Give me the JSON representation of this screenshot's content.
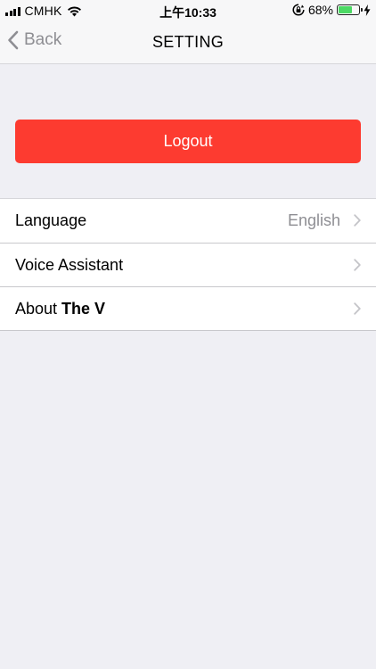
{
  "status_bar": {
    "carrier": "CMHK",
    "time": "上午10:33",
    "battery_percent": "68%",
    "battery_level": 0.68
  },
  "nav": {
    "back_label": "Back",
    "title": "SETTING"
  },
  "logout": {
    "label": "Logout",
    "color": "#fd3b30"
  },
  "settings": {
    "language": {
      "label": "Language",
      "value": "English"
    },
    "voice_assistant": {
      "label": "Voice Assistant"
    },
    "about": {
      "prefix": "About ",
      "app_name": "The V"
    }
  },
  "icons": [
    "signal-icon",
    "wifi-icon",
    "rotation-lock-icon",
    "battery-icon",
    "charging-bolt-icon",
    "chevron-left-icon",
    "chevron-right-icon"
  ]
}
